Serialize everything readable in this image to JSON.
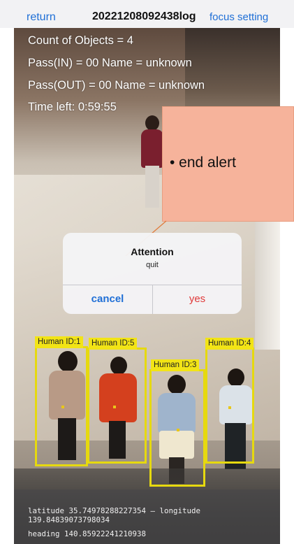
{
  "nav": {
    "return_label": "return",
    "title": "20221208092438log",
    "focus_label": "focus setting"
  },
  "overlay": {
    "count_line": "Count of Objects = 4",
    "pass_in_line": "Pass(IN) = 00 Name = unknown",
    "pass_out_line": "Pass(OUT) = 00 Name = unknown",
    "time_line": "Time left: 0:59:55"
  },
  "callout": {
    "text": "• end alert"
  },
  "dialog": {
    "title": "Attention",
    "message": "quit",
    "cancel_label": "cancel",
    "yes_label": "yes"
  },
  "detections": [
    {
      "label": "Human ID:1"
    },
    {
      "label": "Human ID:5"
    },
    {
      "label": "Human ID:3"
    },
    {
      "label": "Human ID:4"
    }
  ],
  "location": {
    "lat_line": "latitude 35.74978288227354 – longitude",
    "lon_line": "139.84839073798034",
    "heading_line": "heading 140.85922241210938"
  },
  "colors": {
    "link": "#1f6fd6",
    "destructive": "#e03a3a",
    "detection_box": "#e6d90f",
    "callout_fill": "#f6b39b"
  }
}
